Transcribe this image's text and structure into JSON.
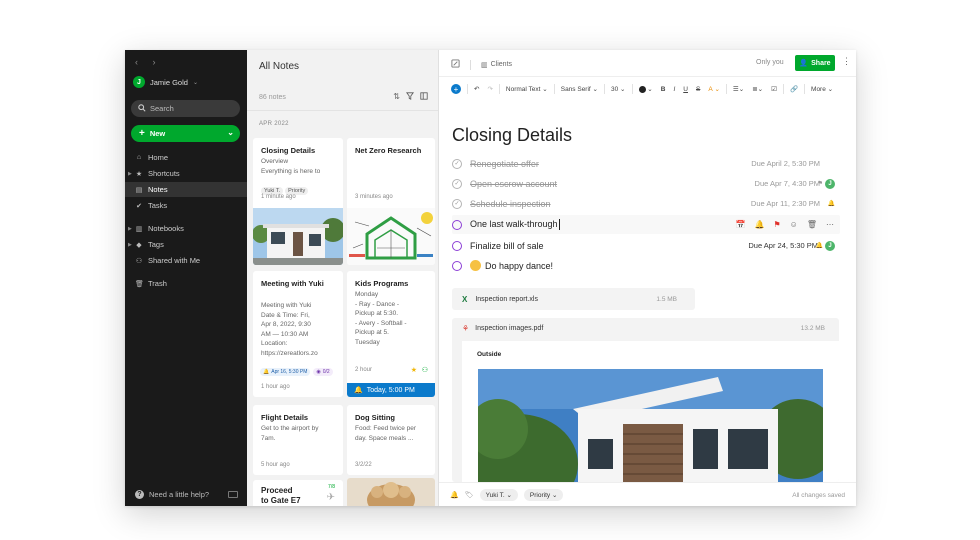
{
  "sidebar": {
    "nav_arrows": "‹ ›",
    "user_name": "Jamie Gold",
    "user_initial": "J",
    "search_placeholder": "Search",
    "new_label": "New",
    "items": [
      {
        "label": "Home",
        "icon": "home-icon"
      },
      {
        "label": "Shortcuts",
        "icon": "star-icon"
      },
      {
        "label": "Notes",
        "icon": "note-icon"
      },
      {
        "label": "Tasks",
        "icon": "check-circle-icon"
      },
      {
        "label": "Notebooks",
        "icon": "notebook-icon"
      },
      {
        "label": "Tags",
        "icon": "tag-icon"
      },
      {
        "label": "Shared with Me",
        "icon": "people-icon"
      },
      {
        "label": "Trash",
        "icon": "trash-icon"
      }
    ],
    "help_label": "Need a little help?"
  },
  "note_list": {
    "title": "All Notes",
    "count": "86 notes",
    "date_group": "APR 2022",
    "cards": [
      {
        "title": "Closing Details",
        "body": "Overview\nEverything is here to",
        "tags": [
          "Yuki T.",
          "Priority"
        ],
        "time": "1 minute ago"
      },
      {
        "title": "Net Zero Research",
        "time": "3 minutes ago"
      },
      {
        "title": "Meeting with Yuki",
        "body": "Meeting with Yuki\nDate & Time:  Fri,\nApr 8, 2022, 9:30\nAM — 10:30 AM\nLocation:\nhttps://zereatlors.zo",
        "reminder": "Apr 16, 5:30 PM",
        "tasks": "0/2",
        "time": "1 hour ago"
      },
      {
        "title": "Kids Programs",
        "body": "Monday\n- Ray - Dance -\nPickup at 5:30.\n- Avery - Softball -\nPickup at 5.\nTuesday",
        "time": "2 hour",
        "reminder_bar": "Today, 5:00 PM"
      },
      {
        "title": "Flight Details",
        "body": "Get to the airport by\n7am.",
        "time": "5 hour ago"
      },
      {
        "title": "Dog Sitting",
        "body": "Food: Feed twice per\nday. Space meals ...",
        "time": "3/2/22"
      },
      {
        "title": "Proceed\nto Gate E7",
        "gate_badge": "7/8"
      }
    ]
  },
  "editor": {
    "notebook": "Clients",
    "only_you": "Only you",
    "share_label": "Share",
    "toolbar": {
      "style": "Normal Text",
      "font": "Sans Serif",
      "size": "30",
      "more": "More"
    },
    "title": "Closing Details",
    "tasks": [
      {
        "text": "Renegotiate offer",
        "done": true,
        "due": "Due April 2, 5:30 PM"
      },
      {
        "text": "Open escrow account",
        "done": true,
        "due": "Due Apr 7, 4:30 PM",
        "assignee": "J"
      },
      {
        "text": "Schedule inspection",
        "done": true,
        "due": "Due Apr 11, 2:30 PM"
      },
      {
        "text": "One last walk-through",
        "done": false,
        "focused": true
      },
      {
        "text": "Finalize bill of sale",
        "done": false,
        "due": "Due Apr 24, 5:30 PM",
        "assignee": "J"
      },
      {
        "text": "Do happy dance!",
        "done": false
      }
    ],
    "attachments": [
      {
        "name": "Inspection report.xls",
        "size": "1.5 MB",
        "icon": "excel-icon",
        "color": "#1d7a3e"
      },
      {
        "name": "Inspection images.pdf",
        "size": "13.2 MB",
        "icon": "pdf-icon",
        "color": "#d9352b"
      }
    ],
    "pdf_section_label": "Outside",
    "footer": {
      "chip_user": "Yuki T.",
      "chip_tag": "Priority",
      "saved": "All changes saved"
    }
  },
  "colors": {
    "brand_green": "#00a82d",
    "sidebar_bg": "#1a1a1a",
    "reminder_blue": "#0b7acb",
    "task_purple": "#8c3fd6"
  }
}
